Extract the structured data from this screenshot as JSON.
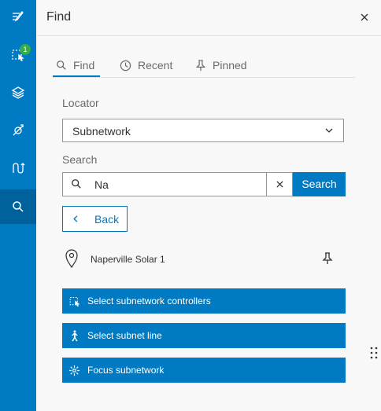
{
  "rail": {
    "selection_badge": "1"
  },
  "panel": {
    "title": "Find"
  },
  "tabs": [
    {
      "label": "Find"
    },
    {
      "label": "Recent"
    },
    {
      "label": "Pinned"
    }
  ],
  "locator": {
    "label": "Locator",
    "selected": "Subnetwork"
  },
  "search": {
    "label": "Search",
    "value": "Na",
    "button_label": "Search"
  },
  "back": {
    "label": "Back"
  },
  "result": {
    "name": "Naperville Solar 1"
  },
  "actions": [
    {
      "label": "Select subnetwork controllers"
    },
    {
      "label": "Select subnet line"
    },
    {
      "label": "Focus subnetwork"
    }
  ],
  "colors": {
    "brand": "#007ac2",
    "rail_active": "#00619b",
    "badge": "#35ac46"
  }
}
